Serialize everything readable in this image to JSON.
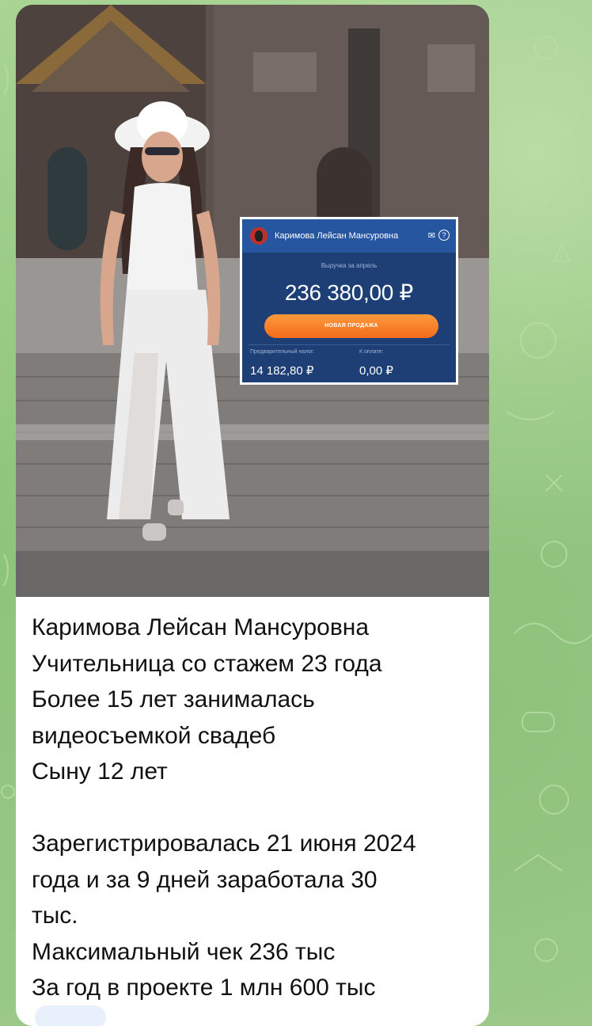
{
  "chat": {
    "wallpaper_color": "#9cc98a",
    "message": {
      "photo": {
        "description_icon": "photo-image",
        "widget": {
          "account_name": "Каримова Лейсан Мансуровна",
          "mail_icon": "✉",
          "help_icon": "?",
          "revenue_label": "Выручка за апрель",
          "revenue_amount": "236 380,00 ₽",
          "button_label": "НОВАЯ ПРОДАЖА",
          "tax_label": "Предварительный налог:",
          "tax_value": "14 182,80 ₽",
          "pay_label": "К оплате:",
          "pay_value": "0,00 ₽",
          "accent_color": "#f36b1c",
          "bg_color": "#1d3f76"
        }
      },
      "text_lines": [
        "Каримова Лейсан Мансуровна",
        "Учительница со стажем 23 года",
        "Более 15 лет занималась",
        "видеосъемкой свадеб",
        "Сыну 12 лет",
        "",
        "Зарегистрировалась 21 июня 2024",
        "года и за 9 дней заработала 30",
        "тыс.",
        "Максимальный чек 236 тыс",
        "За год в проекте 1 млн 600 тыс"
      ]
    }
  }
}
